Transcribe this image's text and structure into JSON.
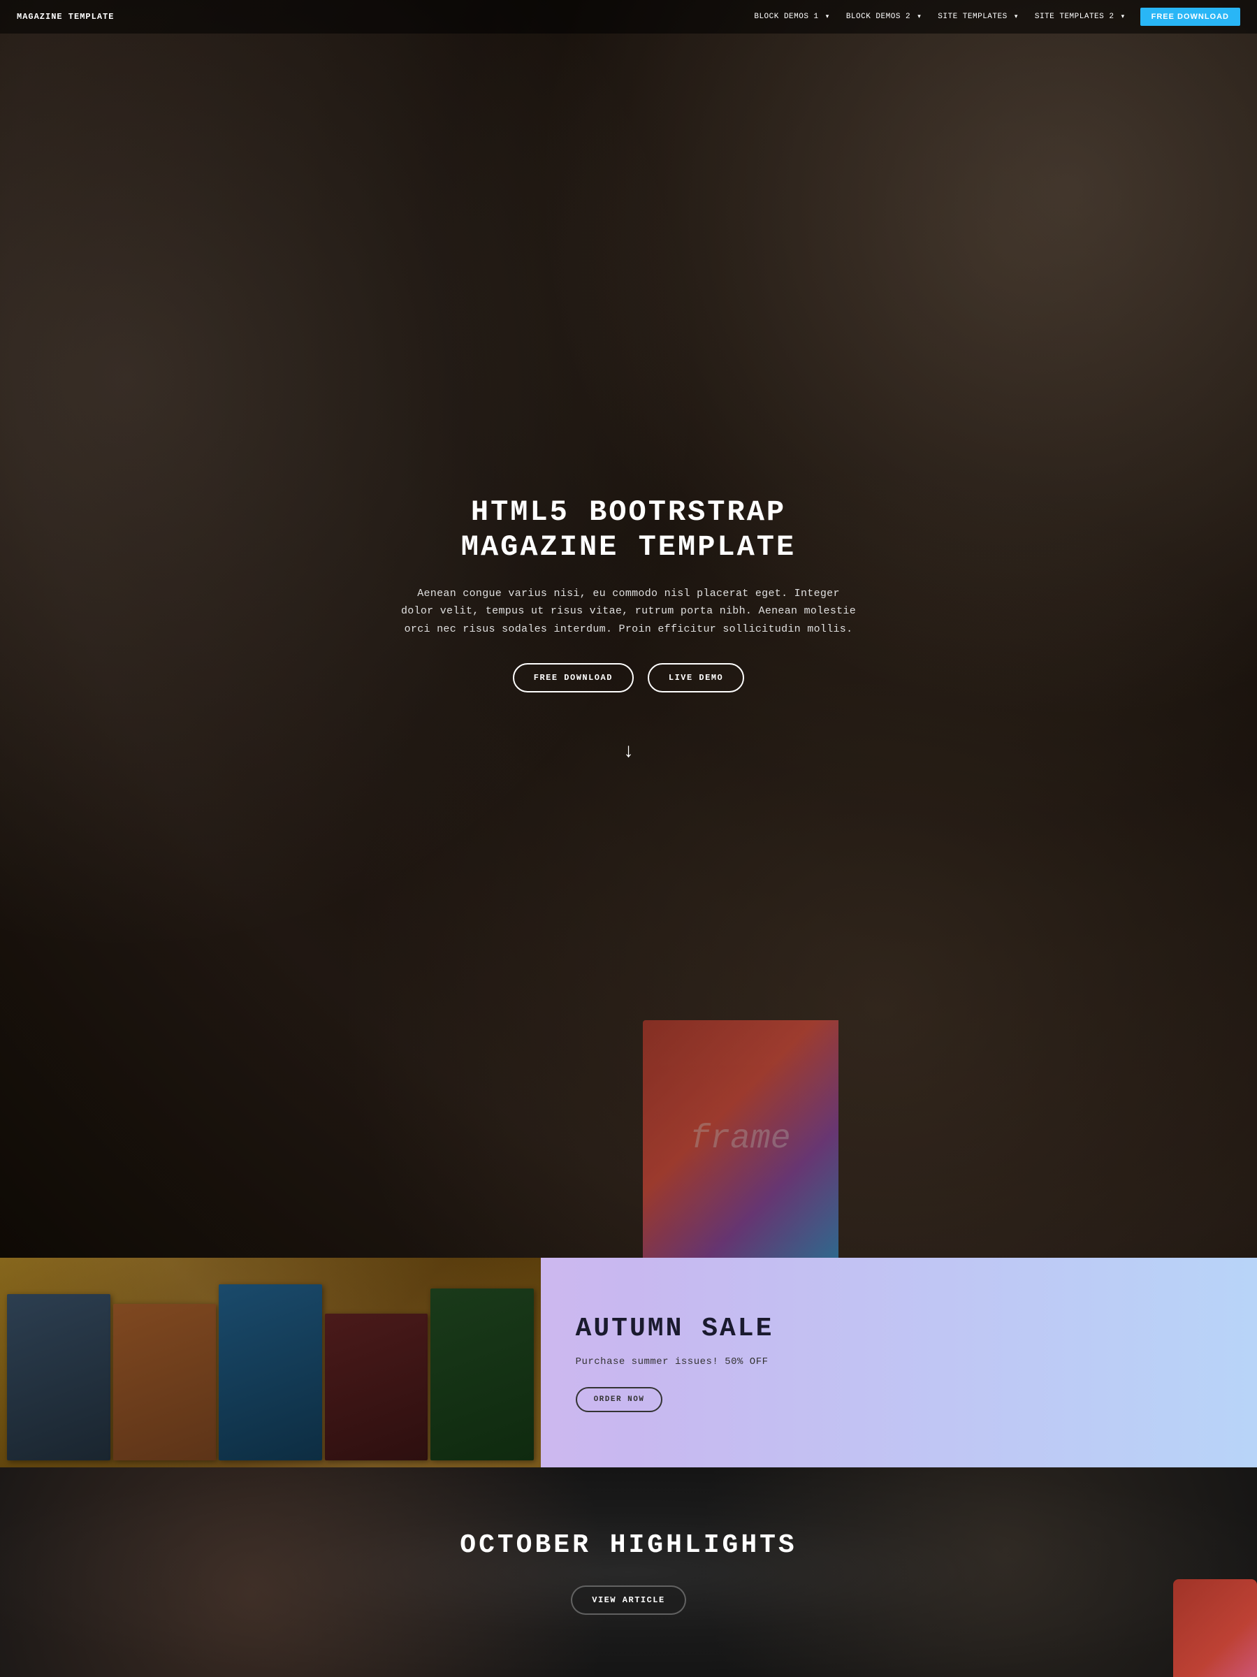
{
  "nav": {
    "brand": "MAGAZINE TEMPLATE",
    "links": [
      {
        "label": "BLOCK DEMOS 1",
        "has_caret": true
      },
      {
        "label": "BLOCK DEMOS 2",
        "has_caret": true
      },
      {
        "label": "SITE TEMPLATES",
        "has_caret": true
      },
      {
        "label": "SITE TEMPLATES 2",
        "has_caret": true
      }
    ],
    "cta_label": "FREE DOWNLOAD"
  },
  "hero": {
    "title": "HTML5 BOOTRSTRAP MAGAZINE TEMPLATE",
    "description": "Aenean congue varius nisi, eu commodo nisl placerat eget. Integer dolor velit, tempus ut risus vitae, rutrum porta nibh. Aenean molestie orci nec risus sodales interdum. Proin efficitur sollicitudin mollis.",
    "btn_download": "FREE DOWNLOAD",
    "btn_demo": "LIVE DEMO",
    "arrow": "↓"
  },
  "autumn": {
    "title": "AUTUMN SALE",
    "description": "Purchase summer issues! 50% OFF",
    "btn_order": "ORDER NOW"
  },
  "october": {
    "title": "OCTOBER HIGHLIGHTS",
    "btn_article": "VIEW ARTICLE"
  }
}
